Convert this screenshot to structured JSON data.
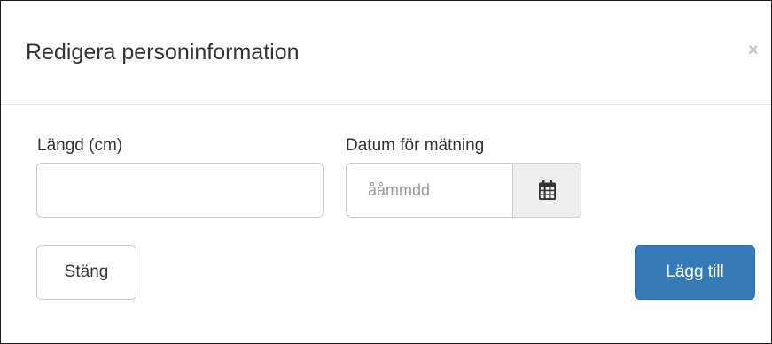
{
  "dialog": {
    "title": "Redigera personinformation",
    "close_symbol": "×"
  },
  "form": {
    "height_label": "Längd (cm)",
    "height_value": "",
    "date_label": "Datum för mätning",
    "date_value": "",
    "date_placeholder": "ååmmdd",
    "date_icon": "calendar-icon"
  },
  "buttons": {
    "close_label": "Stäng",
    "add_label": "Lägg till"
  },
  "colors": {
    "primary": "#337ab7",
    "addon_background": "#eeeeee",
    "border": "#cccccc"
  }
}
